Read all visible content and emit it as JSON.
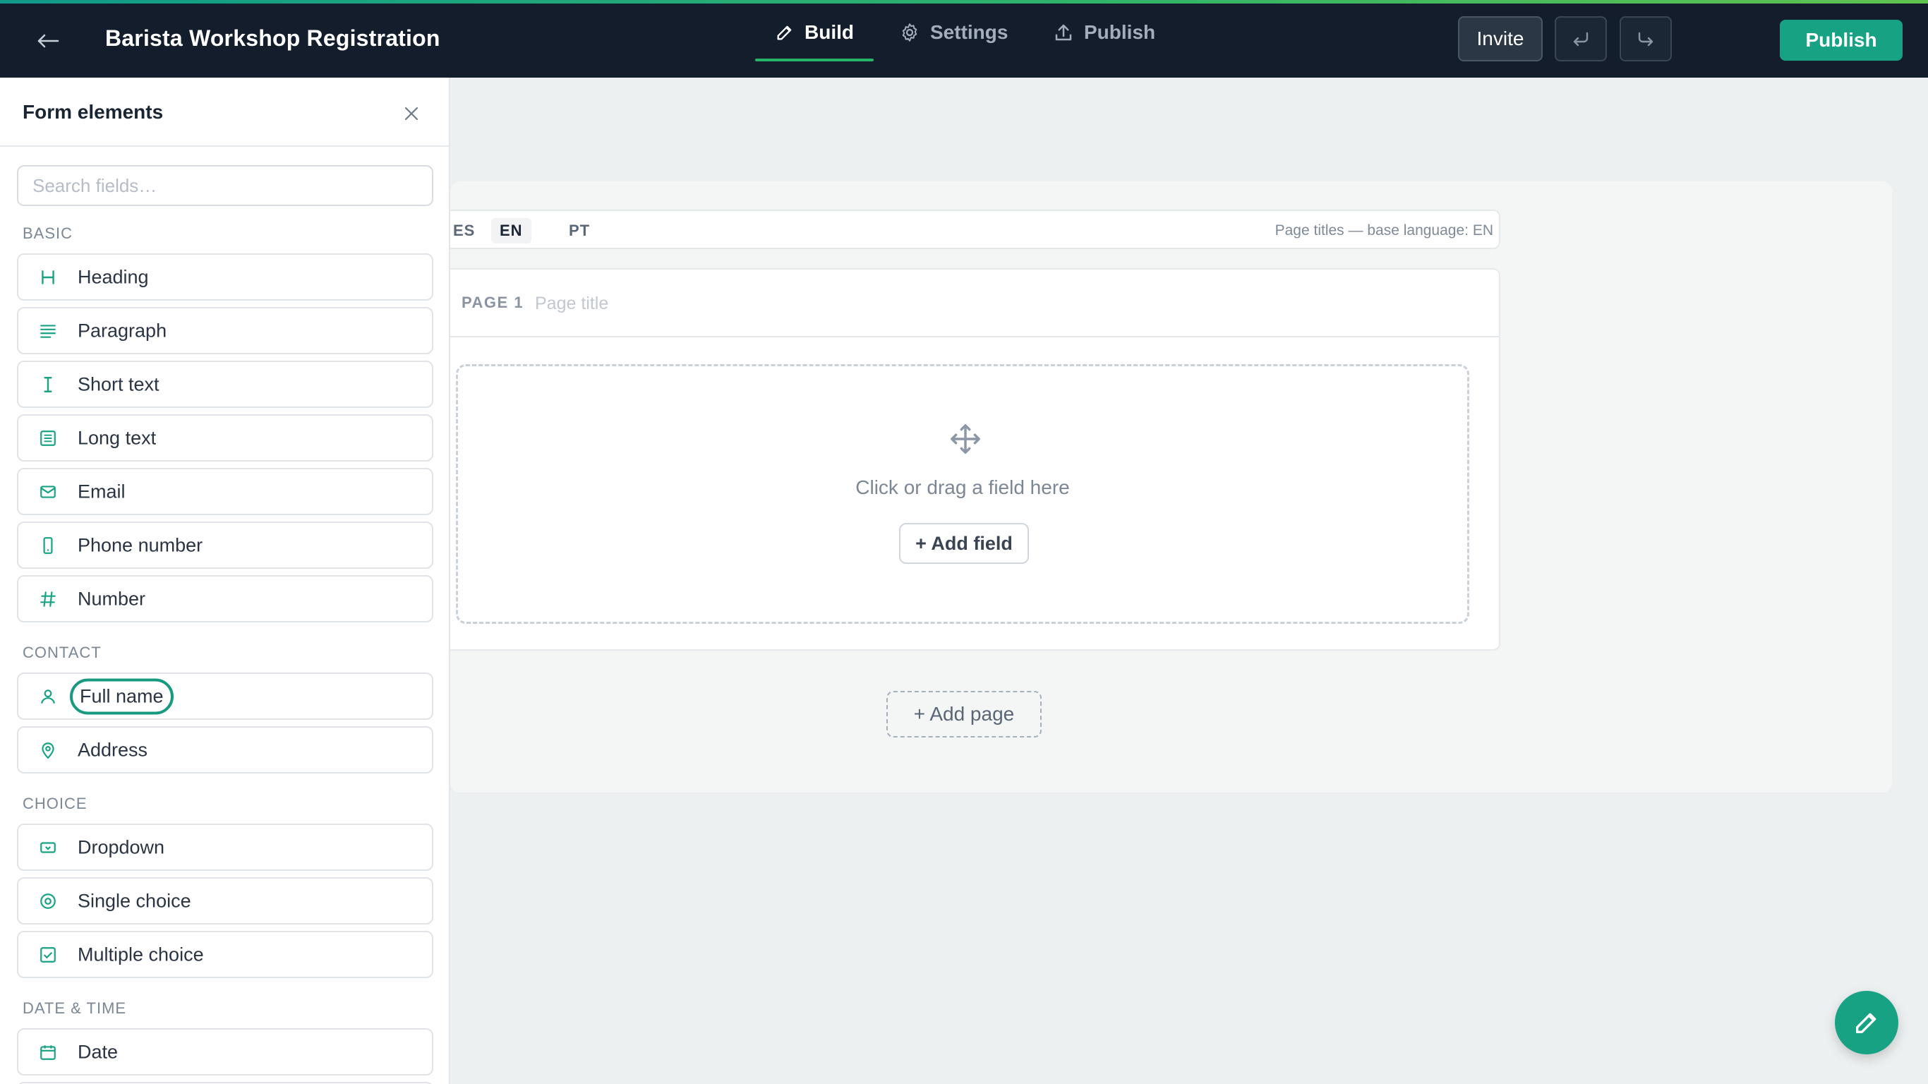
{
  "colors": {
    "accent": "#17a383",
    "topbar_bg": "#131d2c",
    "canvas_bg": "#edf0f0"
  },
  "header": {
    "back_icon": "arrow-left-icon",
    "title": "Barista Workshop Registration",
    "tabs": [
      {
        "label": "Build",
        "icon": "pencil-icon",
        "active": true
      },
      {
        "label": "Settings",
        "icon": "gear-icon",
        "active": false
      },
      {
        "label": "Publish",
        "icon": "upload-icon",
        "active": false
      }
    ],
    "invite_label": "Invite",
    "undo_icon": "undo-icon",
    "redo_icon": "redo-icon",
    "publish_label": "Publish"
  },
  "sidebar": {
    "title": "Form elements",
    "close_icon": "close-icon",
    "search_placeholder": "Search fields…",
    "sections": {
      "basic": "BASIC",
      "contact": "CONTACT",
      "choice": "CHOICE",
      "datetime": "DATE & TIME"
    },
    "basic_items": [
      {
        "label": "Heading",
        "icon": "heading-icon"
      },
      {
        "label": "Paragraph",
        "icon": "paragraph-icon"
      },
      {
        "label": "Short text",
        "icon": "text-cursor-icon"
      },
      {
        "label": "Long text",
        "icon": "long-text-icon"
      },
      {
        "label": "Email",
        "icon": "mail-icon"
      },
      {
        "label": "Phone number",
        "icon": "phone-icon"
      },
      {
        "label": "Number",
        "icon": "hash-icon"
      }
    ],
    "contact_items": [
      {
        "label": "Full name",
        "icon": "user-icon"
      },
      {
        "label": "Address",
        "icon": "location-pin-icon"
      }
    ],
    "choice_items": [
      {
        "label": "Dropdown",
        "icon": "dropdown-icon"
      },
      {
        "label": "Single choice",
        "icon": "radio-icon"
      },
      {
        "label": "Multiple choice",
        "icon": "checkbox-icon"
      }
    ],
    "datetime_items": [
      {
        "label": "Date",
        "icon": "calendar-icon"
      }
    ]
  },
  "canvas": {
    "languages": [
      {
        "code": "ES",
        "active": false
      },
      {
        "code": "EN",
        "active": true
      },
      {
        "code": "PT",
        "active": false
      }
    ],
    "language_note": "Page titles — base language: EN",
    "page_label": "PAGE 1",
    "page_title_placeholder": "Page title",
    "drop_icon": "move-icon",
    "drop_text": "Click or drag a field here",
    "add_field_label": "+ Add field",
    "add_page_label": "+ Add page",
    "fab_icon": "pencil-icon"
  }
}
